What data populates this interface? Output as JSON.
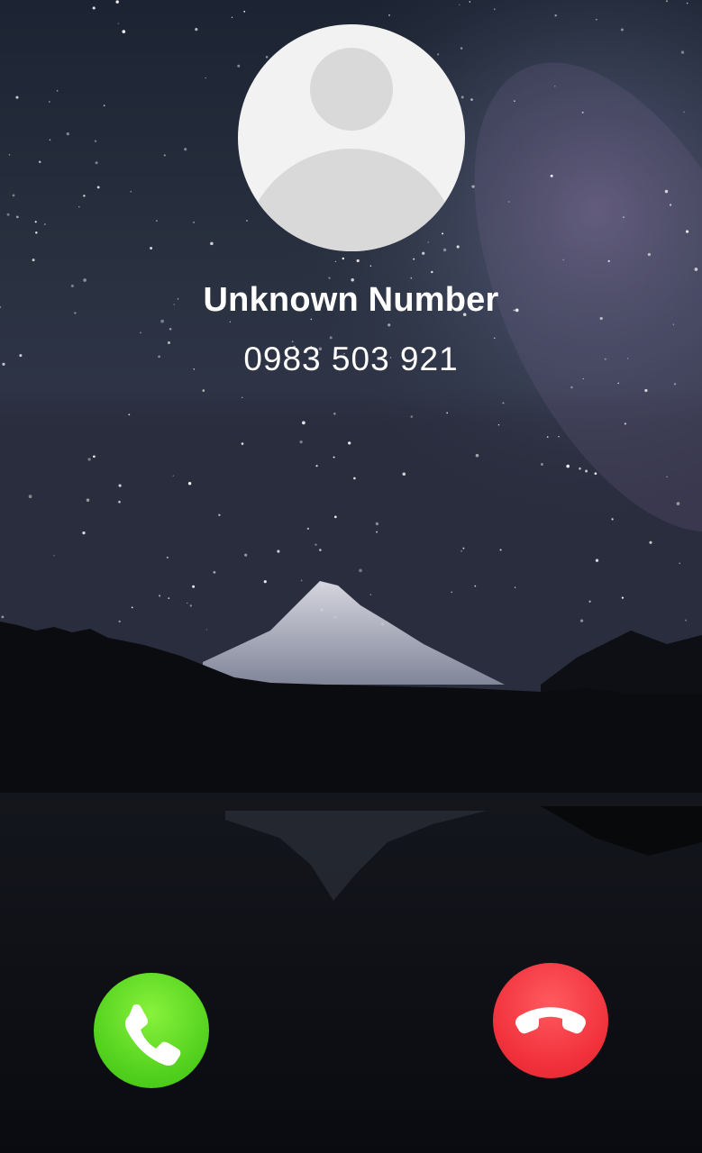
{
  "caller": {
    "name": "Unknown Number",
    "number": "0983 503 921"
  },
  "icons": {
    "avatar": "person-silhouette-icon",
    "accept": "phone-icon",
    "decline": "phone-hangup-icon"
  },
  "colors": {
    "accept": "#52d11e",
    "decline": "#f1313c",
    "avatar_bg": "#f2f2f2",
    "avatar_fg": "#d9d9d9"
  }
}
